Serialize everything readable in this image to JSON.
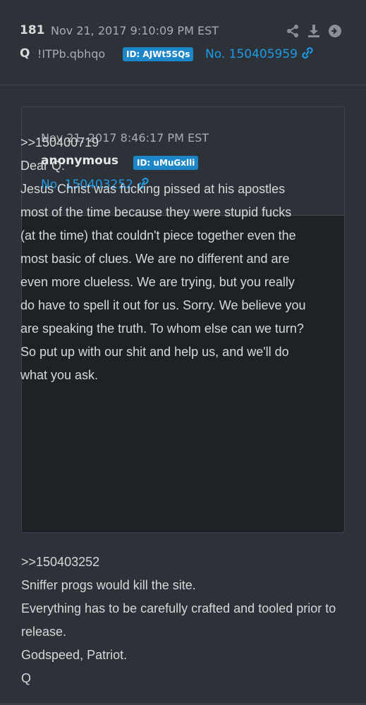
{
  "post": {
    "number": "181",
    "date": "Nov 21, 2017 9:10:09 PM EST",
    "author": "Q",
    "tripcode": "!ITPb.qbhqo",
    "id_badge": "ID: AJWt5SQs",
    "post_no": "No. 150405959",
    "icons": [
      "share-icon",
      "download-icon",
      "forward-arrow-icon",
      "link-icon"
    ]
  },
  "quoted": {
    "date": "Nov 21, 2017 8:46:17 PM EST",
    "author": "anonymous",
    "id_badge": "ID: uMuGxlli",
    "post_no": "No. 150403252",
    "lines": [
      ">>150400719",
      "Dear Q:",
      "Jesus Christ was fucking pissed at his apostles most of the time because they were stupid fucks (at the time) that couldn't piece together even the most basic of clues. We are no different and are even more clueless. We are trying, but you really do have to spell it out for us. Sorry. We believe you are speaking the truth. To whom else can we turn? So put up with our shit and help us, and we'll do what you ask."
    ]
  },
  "reply": {
    "lines": [
      ">>150403252",
      "Sniffer progs would kill the site.",
      "Everything has to be carefully crafted and tooled prior to release.",
      "Godspeed, Patriot.",
      "Q"
    ]
  },
  "colors": {
    "background": "#2d3138",
    "quote_body_bg": "#1e2126",
    "accent_blue": "#1d9be6",
    "badge_blue": "#1c86c9",
    "text": "#d6d8db",
    "muted": "#a9adb3"
  }
}
